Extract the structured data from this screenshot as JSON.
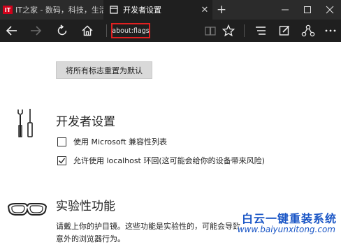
{
  "tabs": [
    {
      "title": "IT之家 - 数码，科技，生活",
      "favicon": "it-home-favicon",
      "active": false
    },
    {
      "title": "开发者设置",
      "favicon": "page-icon",
      "active": true
    }
  ],
  "favicon_text": "IT",
  "address_bar": {
    "value": "about:flags"
  },
  "content": {
    "reset_button": "将所有标志重置为默认",
    "developer_section": {
      "title": "开发者设置",
      "icon": "tools-icon",
      "options": [
        {
          "label": "使用 Microsoft 兼容性列表",
          "checked": false
        },
        {
          "label": "允许使用 localhost 环回(这可能会给你的设备带来风险)",
          "checked": true
        }
      ]
    },
    "experimental_section": {
      "title": "实验性功能",
      "icon": "goggles-icon",
      "description_line1": "请戴上你的护目镜。这些功能是实验性的，可能会导致",
      "description_line2": "意外的浏览器行为。"
    }
  },
  "watermark": {
    "title": "白云一键重装系统",
    "url": "www.baiyunxitong.com"
  },
  "colors": {
    "chrome_dark": "#1f1f1f",
    "tabstrip": "#2b2b2b",
    "highlight_red": "#e02020",
    "watermark_blue": "#1a56c6"
  }
}
